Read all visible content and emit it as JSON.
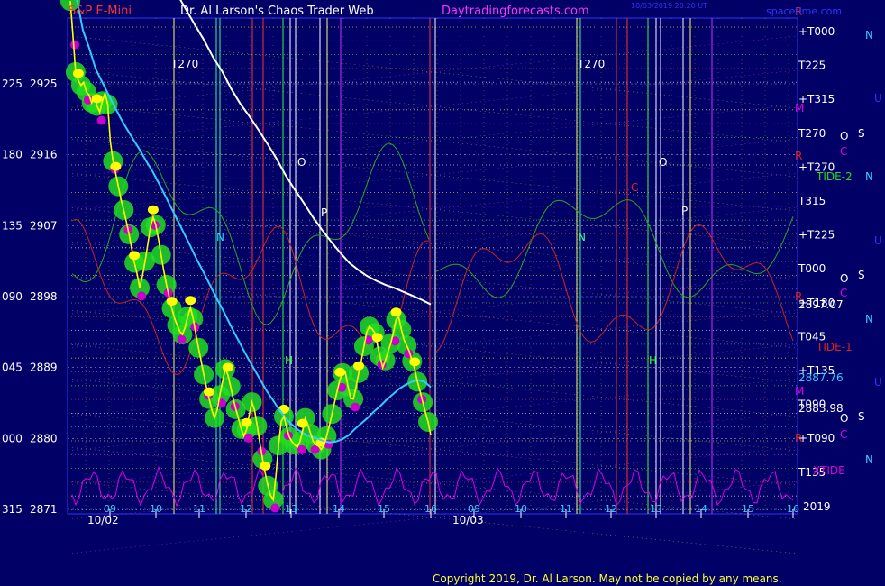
{
  "header": {
    "symbol": "S&P E-Mini",
    "author": "Dr. Al Larson's Chaos Trader Web",
    "site": "Daytradingforecasts.com",
    "brand": "spacetime.com",
    "copyright": "Copyright 2019, Dr. Al Larson. May not be copied by any means."
  },
  "colors": {
    "background": "#000066",
    "price_line": "#ffff00",
    "avg_short": "#33ccff",
    "avg_long": "#ffffff",
    "green_markers": "#22dd22",
    "magenta_markers": "#cc00cc",
    "tide_green": "#22aa22",
    "tide_red": "#cc2222",
    "xtide": "#dd00dd"
  },
  "chart_data": {
    "type": "line",
    "title": "S&P E-Mini",
    "y_ticks": [
      {
        "degree": "225",
        "price": 2925
      },
      {
        "degree": "180",
        "price": 2916
      },
      {
        "degree": "135",
        "price": 2907
      },
      {
        "degree": "090",
        "price": 2898
      },
      {
        "degree": "045",
        "price": 2889
      },
      {
        "degree": "000",
        "price": 2880
      },
      {
        "degree": "315",
        "price": 2871
      }
    ],
    "ylim": [
      2871,
      2925
    ],
    "x_ticks": [
      "09",
      "10",
      "11",
      "12",
      "13",
      "14",
      "15",
      "16",
      "09",
      "10",
      "11",
      "12",
      "13",
      "14",
      "15",
      "16"
    ],
    "date_labels": [
      "10/02",
      "10/03"
    ],
    "year_label": "2019",
    "price_labels": [
      {
        "text": "2897.07",
        "value": 2897.07
      },
      {
        "text": "2887.76",
        "value": 2887.76
      },
      {
        "text": "2883.98",
        "value": 2883.98
      }
    ],
    "series": [
      {
        "key": "price",
        "values": [
          2935.5,
          2931,
          2926.5,
          2925.4,
          2924.8,
          2925.2,
          2924,
          2923.6,
          2922.6,
          2923.4,
          2922.2,
          2921.4,
          2922.8,
          2923.8,
          2922.4,
          2917.7,
          2915.2,
          2913.6,
          2912,
          2910.3,
          2909,
          2907.5,
          2905.9,
          2904.1,
          2902.3,
          2900.9,
          2899.1,
          2900.6,
          2902.5,
          2904.6,
          2906.8,
          2908.1,
          2907.1,
          2905.3,
          2903.3,
          2901.3,
          2899.5,
          2898,
          2896.5,
          2895.3,
          2894.4,
          2893.6,
          2893.2,
          2894.1,
          2895.5,
          2896.6,
          2895.2,
          2893.3,
          2891.5,
          2889.8,
          2888.1,
          2886.5,
          2885,
          2883.6,
          2882.6,
          2883.6,
          2885.5,
          2887.2,
          2888.8,
          2888.1,
          2886.6,
          2885.1,
          2883.7,
          2882.5,
          2881.2,
          2880.3,
          2881.1,
          2883,
          2884.6,
          2883.6,
          2881.6,
          2879.4,
          2877.4,
          2875.6,
          2874,
          2872.8,
          2872.2,
          2875.2,
          2879.1,
          2882.2,
          2882.8,
          2881.4,
          2880.2,
          2879.6,
          2879.2,
          2878.9,
          2879.6,
          2881,
          2882.6,
          2881.7,
          2880.6,
          2879.6,
          2879.2,
          2879,
          2878.6,
          2879.1,
          2880.3,
          2881.6,
          2883.1,
          2884.6,
          2886.1,
          2887.5,
          2888.3,
          2888.4,
          2886.6,
          2885.1,
          2885,
          2886.5,
          2888.3,
          2889.9,
          2891.7,
          2893.5,
          2894.2,
          2893.9,
          2893.4,
          2891.9,
          2890.4,
          2889,
          2889.9,
          2891,
          2892.1,
          2893.4,
          2895.1,
          2895.4,
          2893.8,
          2892.5,
          2891.8,
          2891,
          2889.8,
          2888.8,
          2887.2,
          2886,
          2884.6,
          2883.3,
          2882.1,
          2880.4
        ]
      },
      {
        "key": "avg_short",
        "values": [
          2939.8,
          2935.9,
          2931.8,
          2929.5,
          2926.9,
          2925.3,
          2923.7,
          2922.1,
          2920.6,
          2919.2,
          2917.9,
          2916.6,
          2915.2,
          2913.9,
          2912.4,
          2910.8,
          2909.2,
          2907.6,
          2906,
          2904.4,
          2902.7,
          2901.2,
          2899.6,
          2898,
          2896.5,
          2894.9,
          2893.3,
          2891.8,
          2890.3,
          2888.9,
          2887.5,
          2886.1,
          2884.9,
          2883.7,
          2882.6,
          2881.8,
          2881.1,
          2880.6,
          2880.2,
          2880,
          2879.7,
          2879.5,
          2879.6,
          2879.9,
          2880.4,
          2881.2,
          2881.9,
          2882.6,
          2883.4,
          2884.1,
          2884.9,
          2885.6,
          2886.3,
          2886.8,
          2887.2,
          2887.4,
          2887.2,
          2886.5
        ]
      },
      {
        "key": "avg_long",
        "values": [
          2936.5,
          2934.5,
          2932.5,
          2930.6,
          2928.4,
          2926.6,
          2924.4,
          2922.5,
          2920.9,
          2919.2,
          2917.4,
          2915.5,
          2913.4,
          2911.6,
          2909.9,
          2908.1,
          2906.5,
          2905,
          2903.6,
          2902.3,
          2901.4,
          2900.6,
          2900,
          2899.5,
          2899.1,
          2898.6,
          2898.1,
          2897.6,
          2897
        ]
      }
    ],
    "cycle_labels": [
      "T270",
      "T270",
      "N",
      "N",
      "O",
      "O",
      "P",
      "P",
      "R",
      "R",
      "R",
      "R",
      "H",
      "H",
      "C",
      "M",
      "M",
      "U",
      "U",
      "U",
      "S",
      "S",
      "S",
      "O",
      "O",
      "O",
      "C",
      "C",
      "C",
      "N",
      "N",
      "N",
      "N"
    ],
    "right_labels": [
      "+T000",
      "T225",
      "+T315",
      "T270",
      "+T270",
      "T315",
      "+T225",
      "T000",
      "+T180",
      "T045",
      "+T135",
      "T090",
      "+T090",
      "T135"
    ],
    "tide_labels": [
      "TIDE-2",
      "TIDE-1",
      "XTIDE"
    ],
    "timestamp_lines": [
      "10/03/2019 20:20 UT",
      "spacetime.com"
    ]
  }
}
